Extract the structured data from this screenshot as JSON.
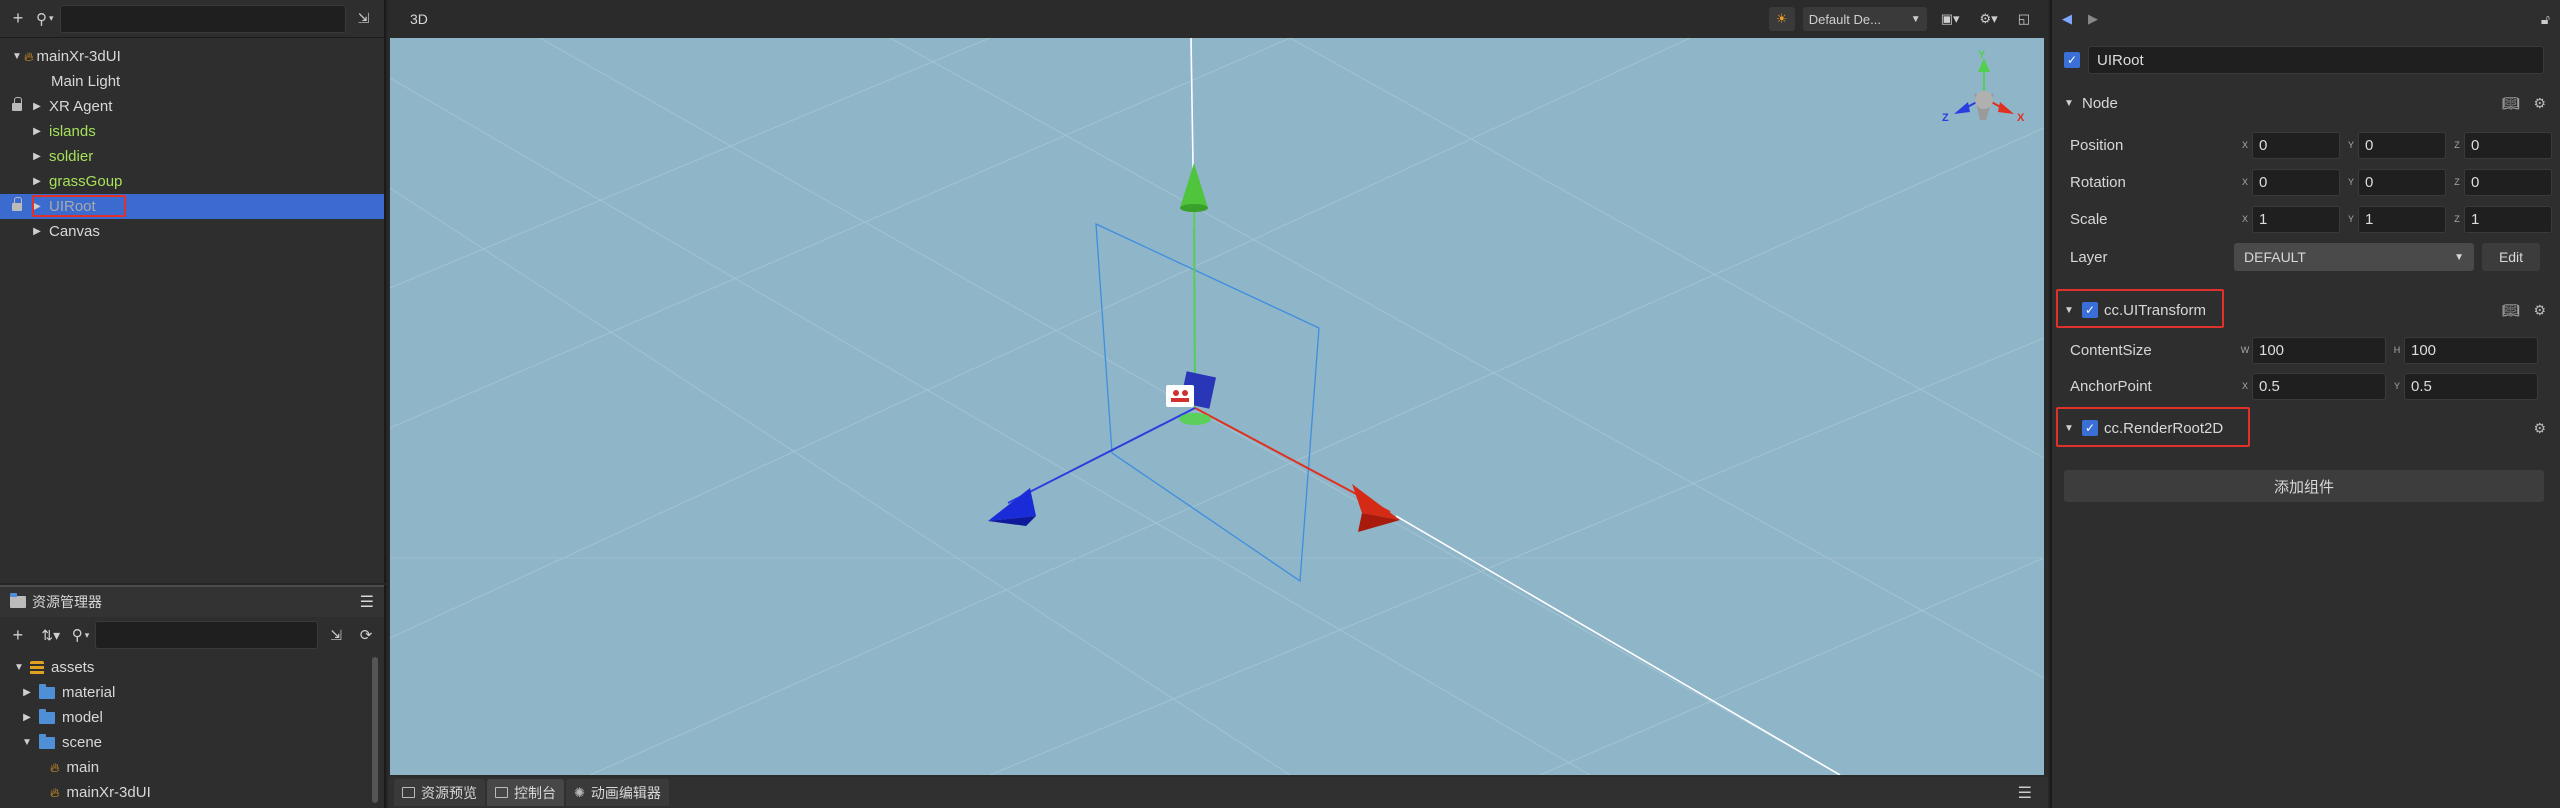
{
  "hierarchy": {
    "search_placeholder": "",
    "nodes": [
      {
        "label": "mainXr-3dUI"
      },
      {
        "label": "Main Light"
      },
      {
        "label": "XR Agent"
      },
      {
        "label": "islands"
      },
      {
        "label": "soldier"
      },
      {
        "label": "grassGoup"
      },
      {
        "label": "UIRoot"
      },
      {
        "label": "Canvas"
      }
    ]
  },
  "assets": {
    "tab_label": "资源管理器",
    "search_placeholder": "",
    "items": [
      {
        "label": "assets"
      },
      {
        "label": "material"
      },
      {
        "label": "model"
      },
      {
        "label": "scene"
      },
      {
        "label": "main"
      },
      {
        "label": "mainXr-3dUI"
      }
    ]
  },
  "scene": {
    "mode_label": "3D",
    "camera_select": "Default De...",
    "bottom_tabs": [
      {
        "label": "资源预览"
      },
      {
        "label": "控制台"
      },
      {
        "label": "动画编辑器"
      }
    ]
  },
  "inspector": {
    "node_name": "UIRoot",
    "node_section": "Node",
    "position": {
      "label": "Position",
      "x": "0",
      "y": "0",
      "z": "0"
    },
    "rotation": {
      "label": "Rotation",
      "x": "0",
      "y": "0",
      "z": "0"
    },
    "scale": {
      "label": "Scale",
      "x": "1",
      "y": "1",
      "z": "1"
    },
    "layer": {
      "label": "Layer",
      "value": "DEFAULT",
      "edit_label": "Edit"
    },
    "ui_transform": {
      "title": "cc.UITransform",
      "content_size_label": "ContentSize",
      "w": "100",
      "h": "100",
      "anchor_label": "AnchorPoint",
      "ax": "0.5",
      "ay": "0.5"
    },
    "render_root": {
      "title": "cc.RenderRoot2D"
    },
    "add_component_label": "添加组件",
    "axis": {
      "x": "X",
      "y": "Y",
      "z": "Z",
      "w": "W",
      "h": "H"
    }
  },
  "colors": {
    "selection": "#3c6bcf",
    "highlight_box": "#e0312b",
    "viewport_bg": "#8fb5c8",
    "green_text": "#a6e05a"
  }
}
